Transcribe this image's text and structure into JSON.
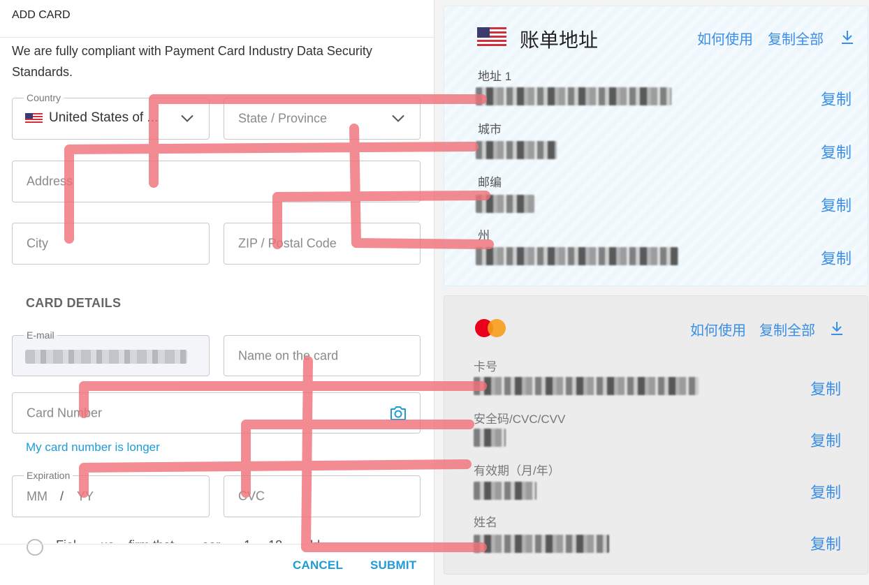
{
  "form": {
    "title": "ADD CARD",
    "compliance": "We are fully compliant with Payment Card Industry Data Security Standards.",
    "country": {
      "legend": "Country",
      "value": "United States of ..."
    },
    "state_placeholder": "State / Province",
    "address_placeholder": "Address",
    "city_placeholder": "City",
    "zip_placeholder": "ZIP / Postal Code",
    "card_details_label": "CARD DETAILS",
    "email": {
      "legend": "E-mail"
    },
    "name_placeholder": "Name on the card",
    "card_number_placeholder": "Card Number",
    "longer_link": "My card number is longer",
    "expiration": {
      "legend": "Expiration",
      "mm": "MM",
      "slash": "/",
      "yy": "YY"
    },
    "cvc_placeholder": "CVC",
    "partial_option_text": "Fiel... ...ue ...firm that ... ...ear... ...1 ... 18 ... ...ld",
    "cancel_label": "CANCEL",
    "submit_label": "SUBMIT"
  },
  "billing": {
    "title": "账单地址",
    "how_to_use": "如何使用",
    "copy_all": "复制全部",
    "rows": [
      {
        "label": "地址 1",
        "copy": "复制"
      },
      {
        "label": "城市",
        "copy": "复制"
      },
      {
        "label": "邮编",
        "copy": "复制"
      },
      {
        "label": "州",
        "copy": "复制"
      }
    ]
  },
  "card": {
    "how_to_use": "如何使用",
    "copy_all": "复制全部",
    "rows": [
      {
        "label": "卡号",
        "copy": "复制"
      },
      {
        "label": "安全码/CVC/CVV",
        "copy": "复制"
      },
      {
        "label": "有效期（月/年）",
        "copy": "复制"
      },
      {
        "label": "姓名",
        "copy": "复制"
      }
    ]
  },
  "icons": {
    "flag": "us-flag-icon",
    "dropdown": "chevron-down-icon",
    "camera": "camera-icon",
    "download": "download-icon",
    "card_brand": "mastercard-logo"
  },
  "colors": {
    "accent": "#1f9bd7",
    "link_blue": "#3a8ee6",
    "annotation_red": "#f07078",
    "mastercard_red": "#eb001b",
    "mastercard_orange": "#f79e1b"
  }
}
